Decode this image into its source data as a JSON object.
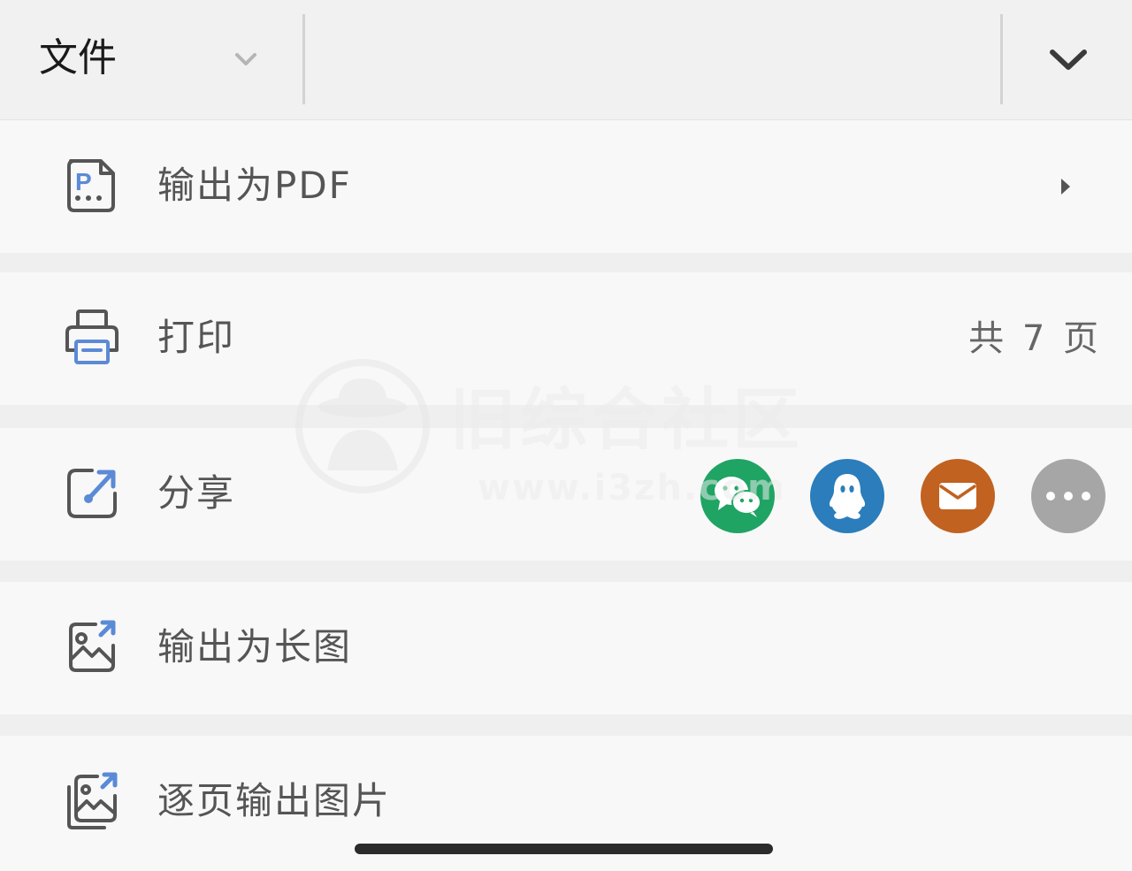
{
  "toolbar": {
    "menu_title": "文件"
  },
  "rows": [
    {
      "label": "输出为PDF",
      "icon": "pdf-icon"
    },
    {
      "label": "打印",
      "icon": "printer-icon",
      "value": "共 7 页"
    },
    {
      "label": "分享",
      "icon": "share-icon"
    },
    {
      "label": "输出为长图",
      "icon": "long-image-icon"
    },
    {
      "label": "逐页输出图片",
      "icon": "page-images-icon"
    }
  ],
  "share_targets": [
    {
      "name": "wechat",
      "icon": "wechat-icon",
      "color": "#1fa463"
    },
    {
      "name": "qq",
      "icon": "qq-icon",
      "color": "#2b7dbb"
    },
    {
      "name": "mail",
      "icon": "mail-icon",
      "color": "#c16220"
    },
    {
      "name": "more",
      "icon": "more-icon",
      "color": "#a6a6a6"
    }
  ],
  "watermark": {
    "text": "旧综合社区",
    "url": "www.i3zh.com"
  },
  "colors": {
    "accent_blue": "#5b8ad6",
    "icon_gray": "#555555"
  }
}
